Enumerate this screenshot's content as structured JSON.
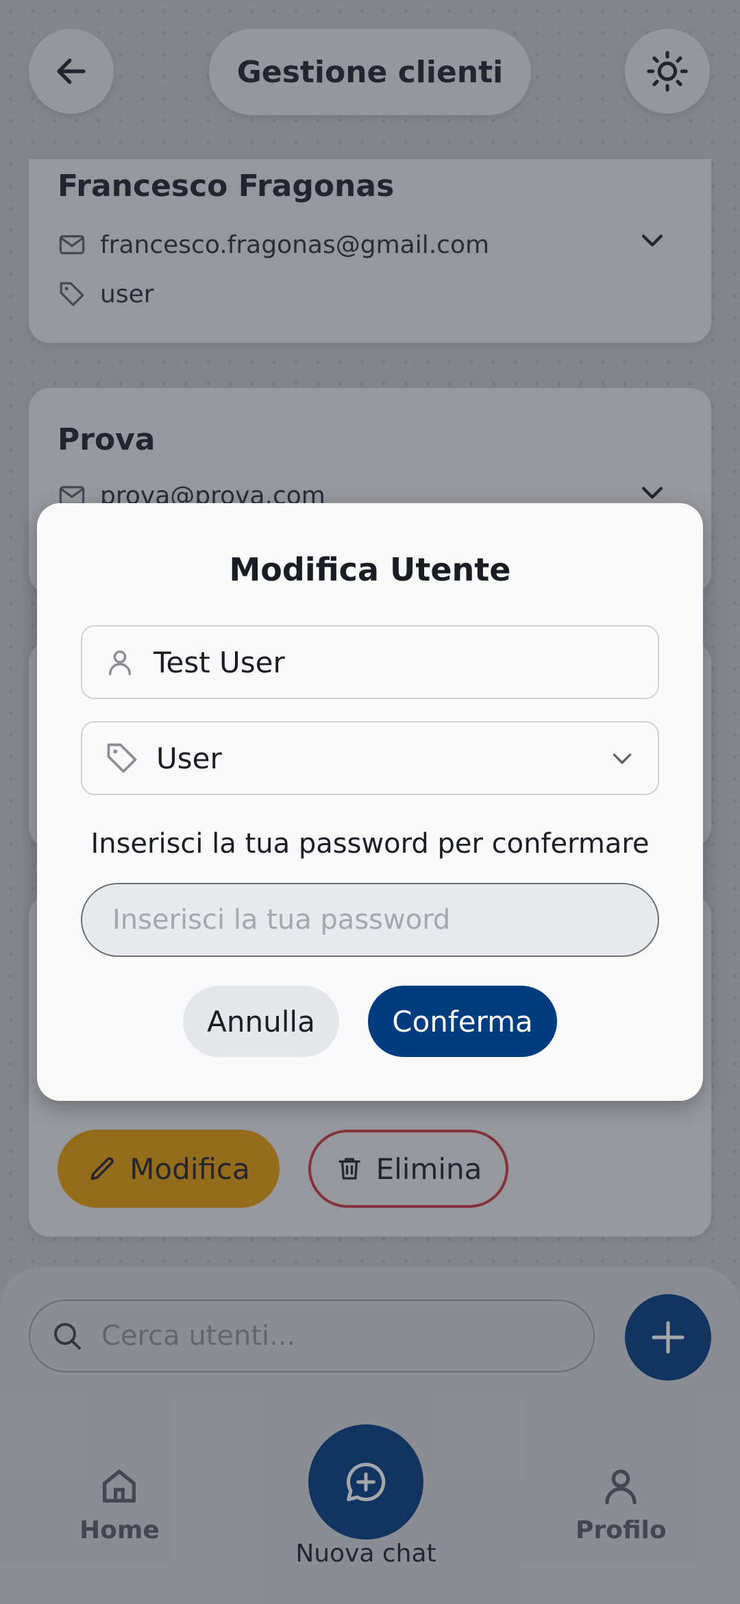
{
  "header": {
    "title": "Gestione clienti",
    "back_icon": "arrow-left-icon",
    "theme_icon": "sun-icon"
  },
  "cards": [
    {
      "name": "Francesco Fragonas",
      "email": "francesco.fragonas@gmail.com",
      "role": "user"
    },
    {
      "name": "Prova",
      "email": "prova@prova.com"
    }
  ],
  "card_actions": {
    "edit_label": "Modifica",
    "delete_label": "Elimina"
  },
  "search": {
    "placeholder": "Cerca utenti..."
  },
  "nav": {
    "home": "Home",
    "new_chat": "Nuova chat",
    "profile": "Profilo"
  },
  "modal": {
    "title": "Modifica Utente",
    "name_value": "Test User",
    "role_value": "User",
    "confirm_text": "Inserisci la tua password per confermare",
    "password_placeholder": "Inserisci la tua password",
    "cancel_label": "Annulla",
    "confirm_label": "Conferma"
  },
  "colors": {
    "primary": "#003d80",
    "edit": "#e39b0b",
    "delete": "#c8373b"
  }
}
